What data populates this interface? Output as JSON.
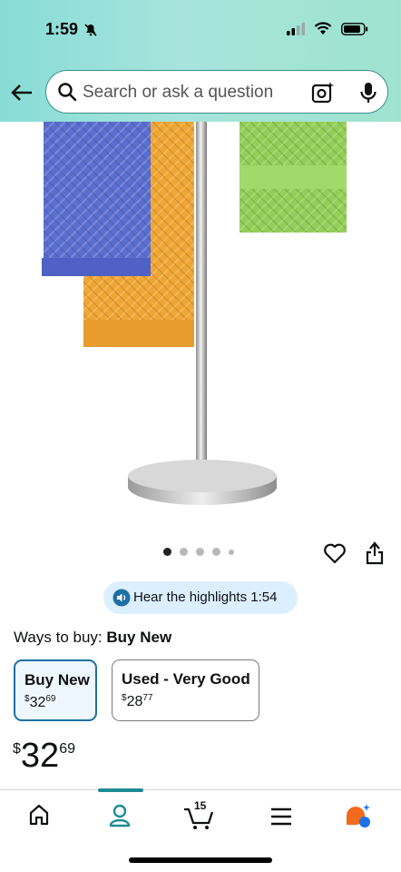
{
  "status_bar": {
    "time": "1:59"
  },
  "search": {
    "placeholder": "Search or ask a question"
  },
  "highlights": {
    "label": "Hear the highlights 1:54"
  },
  "ways_to_buy": {
    "label": "Ways to buy:",
    "selected": "Buy New"
  },
  "options": [
    {
      "title": "Buy New",
      "price_symbol": "$",
      "price_whole": "32",
      "price_fraction": "69"
    },
    {
      "title": "Used - Very Good",
      "price_symbol": "$",
      "price_whole": "28",
      "price_fraction": "77"
    }
  ],
  "price": {
    "symbol": "$",
    "whole": "32",
    "fraction": "69"
  },
  "carousel": {
    "dots": 5,
    "active_index": 0
  },
  "cart": {
    "count": "15"
  },
  "colors": {
    "accent": "#1f8b96",
    "selected_border": "#1d6fa5",
    "pill_bg": "#dcefff",
    "assistant_orange": "#f26a1b",
    "assistant_blue": "#1a73e8"
  },
  "nav_icons": [
    "home-icon",
    "account-icon",
    "cart-icon",
    "menu-icon",
    "assistant-icon"
  ]
}
